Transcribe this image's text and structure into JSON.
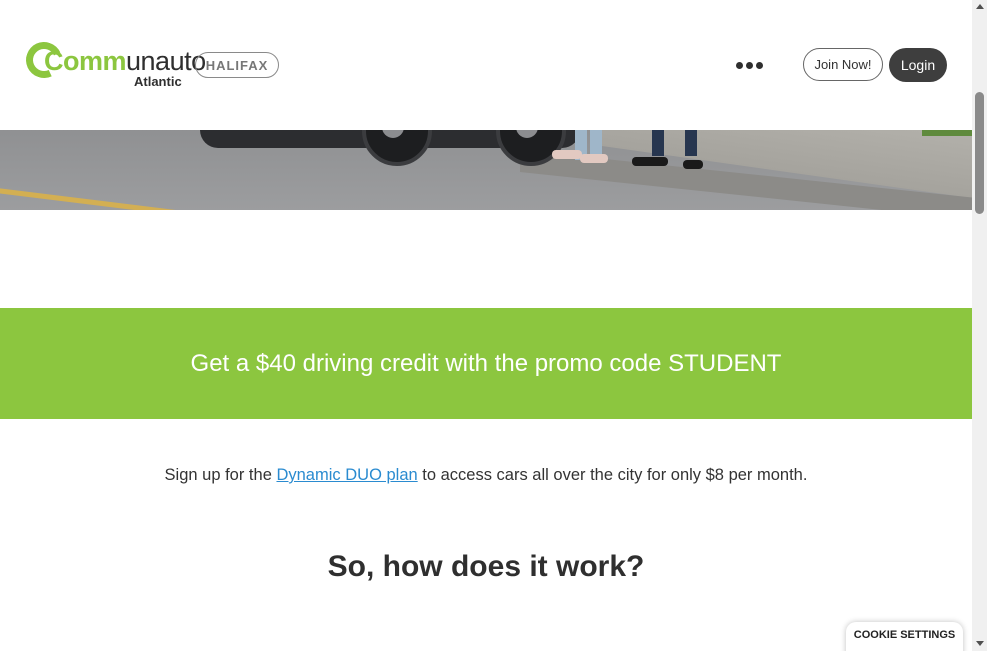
{
  "header": {
    "logo": {
      "brand_green": "Comm",
      "brand_dark": "unauto",
      "sub": "Atlantic"
    },
    "city_badge": "HALIFAX",
    "more_menu_icon": "more-horizontal-icon",
    "join_label": "Join Now!",
    "login_label": "Login"
  },
  "promo": {
    "text": "Get a $40 driving credit with the promo code STUDENT"
  },
  "signup": {
    "before": "Sign up for the ",
    "link": "Dynamic DUO plan",
    "after": " to access cars all over the city for only $8 per month."
  },
  "section_heading": "So, how does it work?",
  "cookie_button": "COOKIE SETTINGS",
  "colors": {
    "brand_green": "#8cc63f",
    "dark": "#3e3e3e",
    "link": "#2a8bd0"
  }
}
